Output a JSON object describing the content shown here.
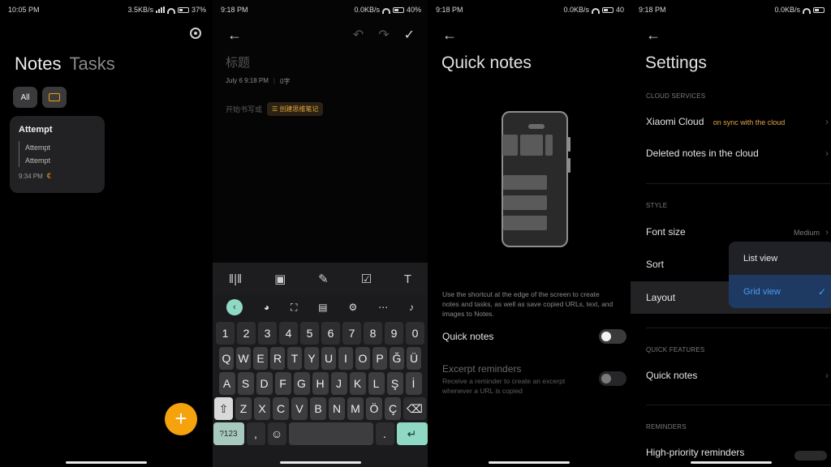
{
  "panel1": {
    "status": {
      "time": "10:05 PM",
      "speed": "3.5KB/s",
      "battery": "37%"
    },
    "tab_notes": "Notes",
    "tab_tasks": "Tasks",
    "chip_all": "All",
    "note": {
      "title": "Attempt",
      "lines": [
        "Attempt",
        "Attempt"
      ],
      "time": "9:34 PM",
      "mark": "€"
    },
    "fab_label": "+"
  },
  "panel2": {
    "status": {
      "time": "9:18 PM",
      "speed": "0.0KB/s",
      "battery": "40%"
    },
    "title_placeholder": "标题",
    "date": "July 6 9:18 PM",
    "chars": "0字",
    "body_placeholder": "开始书写或",
    "mind_map_chip": "创建思维笔记",
    "number_row": [
      "1",
      "2",
      "3",
      "4",
      "5",
      "6",
      "7",
      "8",
      "9",
      "0"
    ],
    "row1": [
      "Q",
      "W",
      "E",
      "R",
      "T",
      "Y",
      "U",
      "I",
      "O",
      "P",
      "Ğ",
      "Ü"
    ],
    "row2": [
      "A",
      "S",
      "D",
      "F",
      "G",
      "H",
      "J",
      "K",
      "L",
      "Ş",
      "İ"
    ],
    "row3": [
      "Z",
      "X",
      "C",
      "V",
      "B",
      "N",
      "M",
      "Ö",
      "Ç"
    ],
    "sym_key": "?123",
    "comma_key": ",",
    "period_key": "."
  },
  "panel3": {
    "status": {
      "time": "9:18 PM",
      "speed": "0.0KB/s",
      "battery": "40"
    },
    "title": "Quick notes",
    "description": "Use the shortcut at the edge of the screen to create notes and tasks, as well as save copied URLs, text, and images to Notes.",
    "quick_notes_label": "Quick notes",
    "excerpt_label": "Excerpt reminders",
    "excerpt_sub": "Receive a reminder to create an excerpt whenever a URL is copied"
  },
  "panel4": {
    "status": {
      "time": "9:18 PM",
      "speed": "0.0KB/s"
    },
    "title": "Settings",
    "cloud_services": "CLOUD SERVICES",
    "xiaomi_cloud": "Xiaomi Cloud",
    "xiaomi_cloud_val": "on sync with the cloud",
    "deleted_notes": "Deleted notes in the cloud",
    "style": "STYLE",
    "font_size": "Font size",
    "font_size_val": "Medium",
    "sort": "Sort",
    "layout": "Layout",
    "list_view": "List view",
    "grid_view": "Grid view",
    "quick_features": "QUICK FEATURES",
    "quick_notes": "Quick notes",
    "reminders": "REMINDERS",
    "high_priority": "High-priority reminders"
  }
}
